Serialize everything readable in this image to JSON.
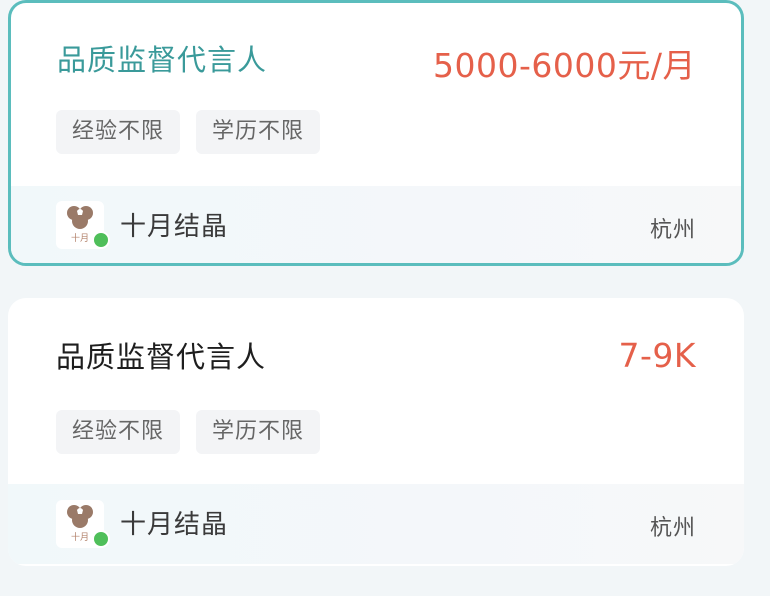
{
  "jobs": [
    {
      "title": "品质监督代言人",
      "salary": "5000-6000元/月",
      "tags": [
        "经验不限",
        "学历不限"
      ],
      "company": "十月结晶",
      "city": "杭州",
      "logo_text": "十月",
      "selected": true
    },
    {
      "title": "品质监督代言人",
      "salary": "7-9K",
      "tags": [
        "经验不限",
        "学历不限"
      ],
      "company": "十月结晶",
      "city": "杭州",
      "logo_text": "十月",
      "selected": false
    }
  ],
  "colors": {
    "accent": "#5bbdbd",
    "selected_title": "#3a9a9a",
    "salary": "#e5604a",
    "online": "#4fbf5a"
  },
  "icons": [
    "company-logo",
    "online-status-dot"
  ]
}
